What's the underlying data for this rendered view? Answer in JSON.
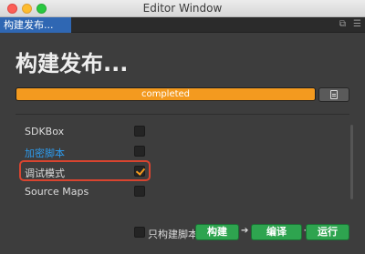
{
  "window": {
    "title": "Editor Window"
  },
  "tab": {
    "label": "构建发布..."
  },
  "tab_icons": [
    "window-restore-icon",
    "menu-icon"
  ],
  "heading": "构建发布...",
  "progress": {
    "text": "completed",
    "value": 1.0,
    "color": "#f39a1f"
  },
  "options": [
    {
      "label": "SDKBox",
      "checked": false,
      "link": false
    },
    {
      "label": "加密脚本",
      "checked": false,
      "link": true
    },
    {
      "label": "调试模式",
      "checked": true,
      "link": false
    },
    {
      "label": "Source Maps",
      "checked": false,
      "link": false
    }
  ],
  "footer": {
    "build_only_label": "只构建脚本",
    "build_label": "构建",
    "compile_label": "编译",
    "run_label": "运行",
    "arrow": "➔"
  },
  "colors": {
    "accent": "#f39a1f",
    "button_green": "#2ea44f",
    "tab_blue": "#2f67b3",
    "link_blue": "#2d9cef",
    "highlight_red": "#d9442f"
  }
}
